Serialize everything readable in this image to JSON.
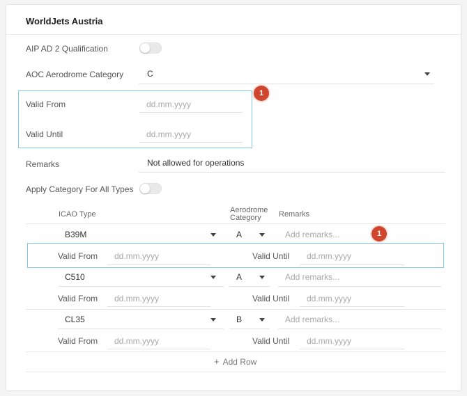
{
  "section": {
    "title": "WorldJets Austria",
    "aip_label": "AIP AD 2 Qualification",
    "aoc_label": "AOC Aerodrome Category",
    "aoc_value": "C",
    "valid_from_label": "Valid From",
    "valid_until_label": "Valid Until",
    "date_placeholder": "dd.mm.yyyy",
    "remarks_label": "Remarks",
    "remarks_value": "Not allowed for operations",
    "apply_label": "Apply Category For All Types",
    "badge_top": "1"
  },
  "table": {
    "col_icao": "ICAO Type",
    "col_aero_line1": "Aerodrome",
    "col_aero_line2": "Category",
    "col_remarks": "Remarks",
    "remarks_placeholder": "Add remarks...",
    "valid_from_label": "Valid From",
    "valid_until_label": "Valid Until",
    "date_placeholder": "dd.mm.yyyy",
    "rows": [
      {
        "icao": "B39M",
        "category": "A"
      },
      {
        "icao": "C510",
        "category": "A"
      },
      {
        "icao": "CL35",
        "category": "B"
      }
    ],
    "badge_row": "1",
    "add_row_label": "Add Row",
    "add_row_icon": "+"
  },
  "colors": {
    "accent": "#e0622f",
    "highlight": "#7fc9e6",
    "badge": "#d0452d"
  }
}
